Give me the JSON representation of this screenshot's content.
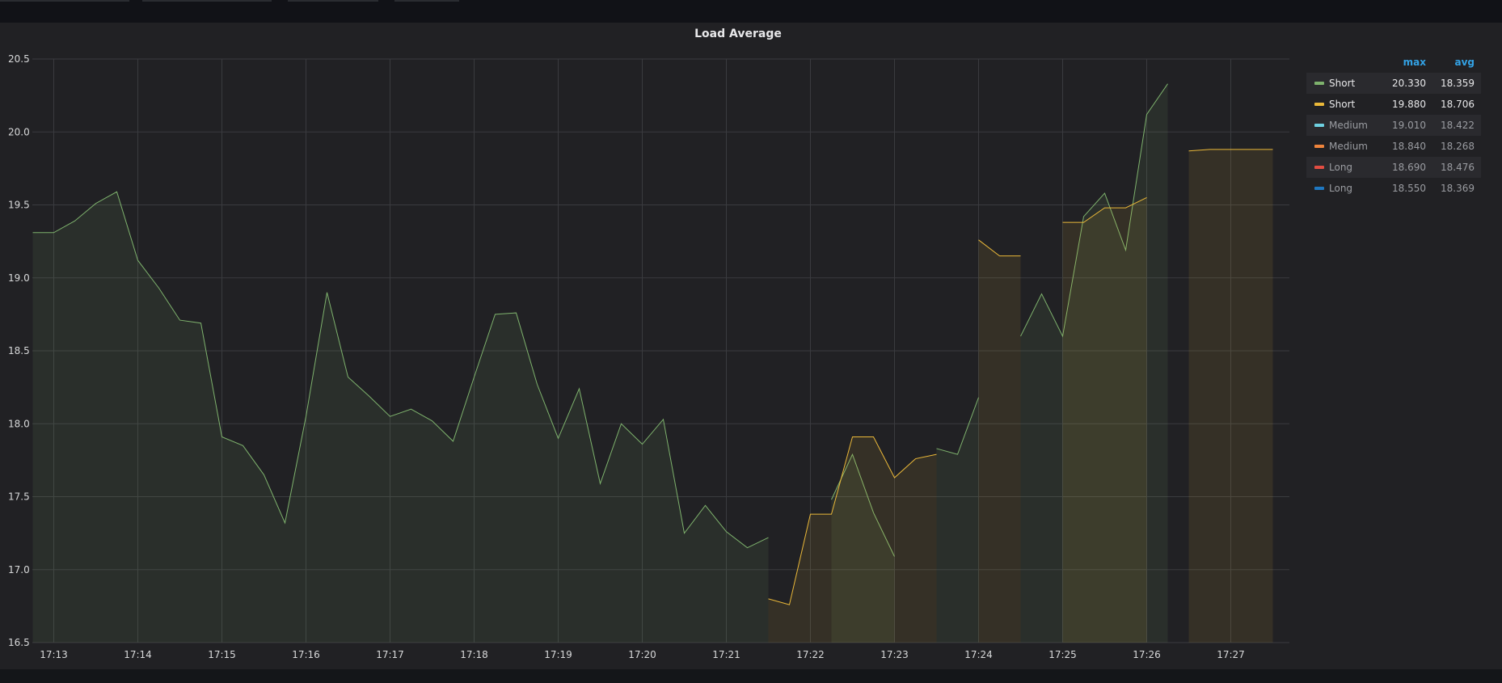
{
  "panel": {
    "title": "Load Average"
  },
  "colors": {
    "background": "#212124",
    "grid": "#3a3b3f",
    "series_short_green": "#7eb26d",
    "series_short_yellow": "#eab839",
    "series_medium_cyan": "#6ed0e0",
    "series_medium_orange": "#ef843c",
    "series_long_red": "#e24d42",
    "series_long_blue": "#1f78c1",
    "legend_header": "#33a2e5"
  },
  "legend": {
    "header_max": "max",
    "header_avg": "avg",
    "items": [
      {
        "name": "Short",
        "max": "20.330",
        "avg": "18.359",
        "color": "#7eb26d"
      },
      {
        "name": "Short",
        "max": "19.880",
        "avg": "18.706",
        "color": "#eab839"
      },
      {
        "name": "Medium",
        "max": "19.010",
        "avg": "18.422",
        "color": "#6ed0e0"
      },
      {
        "name": "Medium",
        "max": "18.840",
        "avg": "18.268",
        "color": "#ef843c"
      },
      {
        "name": "Long",
        "max": "18.690",
        "avg": "18.476",
        "color": "#e24d42"
      },
      {
        "name": "Long",
        "max": "18.550",
        "avg": "18.369",
        "color": "#1f78c1"
      }
    ]
  },
  "chart_data": {
    "type": "area",
    "title": "Load Average",
    "xlabel": "",
    "ylabel": "",
    "ylim": [
      16.5,
      20.5
    ],
    "xlim": [
      "17:12:45",
      "17:27:45"
    ],
    "grid": true,
    "legend_position": "right",
    "y_ticks": [
      "16.5",
      "17.0",
      "17.5",
      "18.0",
      "18.5",
      "19.0",
      "19.5",
      "20.0",
      "20.5"
    ],
    "x_ticks": [
      "17:13",
      "17:14",
      "17:15",
      "17:16",
      "17:17",
      "17:18",
      "17:19",
      "17:20",
      "17:21",
      "17:22",
      "17:23",
      "17:24",
      "17:25",
      "17:26",
      "17:27"
    ],
    "series": [
      {
        "name": "Short",
        "color": "#7eb26d",
        "segments": [
          [
            [
              "17:12:45",
              19.31
            ],
            [
              "17:13:00",
              19.31
            ],
            [
              "17:13:15",
              19.39
            ],
            [
              "17:13:30",
              19.51
            ],
            [
              "17:13:45",
              19.59
            ],
            [
              "17:14:00",
              19.12
            ],
            [
              "17:14:15",
              18.93
            ],
            [
              "17:14:30",
              18.71
            ],
            [
              "17:14:45",
              18.69
            ],
            [
              "17:15:00",
              17.91
            ],
            [
              "17:15:15",
              17.85
            ],
            [
              "17:15:30",
              17.65
            ],
            [
              "17:15:45",
              17.32
            ],
            [
              "17:16:00",
              18.05
            ],
            [
              "17:16:15",
              18.9
            ],
            [
              "17:16:30",
              18.32
            ],
            [
              "17:16:45",
              18.19
            ],
            [
              "17:17:00",
              18.05
            ],
            [
              "17:17:15",
              18.1
            ],
            [
              "17:17:30",
              18.02
            ],
            [
              "17:17:45",
              17.88
            ],
            [
              "17:18:00",
              18.32
            ],
            [
              "17:18:15",
              18.75
            ],
            [
              "17:18:30",
              18.76
            ],
            [
              "17:18:45",
              18.27
            ],
            [
              "17:19:00",
              17.9
            ],
            [
              "17:19:15",
              18.24
            ],
            [
              "17:19:30",
              17.59
            ],
            [
              "17:19:45",
              18.0
            ],
            [
              "17:20:00",
              17.86
            ],
            [
              "17:20:15",
              18.03
            ],
            [
              "17:20:30",
              17.25
            ],
            [
              "17:20:45",
              17.44
            ],
            [
              "17:21:00",
              17.26
            ],
            [
              "17:21:15",
              17.15
            ],
            [
              "17:21:30",
              17.22
            ]
          ],
          [
            [
              "17:22:15",
              17.48
            ],
            [
              "17:22:30",
              17.79
            ],
            [
              "17:22:45",
              17.39
            ],
            [
              "17:23:00",
              17.09
            ]
          ],
          [
            [
              "17:23:30",
              17.83
            ],
            [
              "17:23:45",
              17.79
            ],
            [
              "17:24:00",
              18.18
            ]
          ],
          [
            [
              "17:24:30",
              18.6
            ],
            [
              "17:24:45",
              18.89
            ],
            [
              "17:25:00",
              18.6
            ],
            [
              "17:25:15",
              19.42
            ],
            [
              "17:25:30",
              19.58
            ],
            [
              "17:25:45",
              19.19
            ],
            [
              "17:26:00",
              20.12
            ],
            [
              "17:26:15",
              20.33
            ]
          ]
        ]
      },
      {
        "name": "Short",
        "color": "#eab839",
        "segments": [
          [
            [
              "17:21:30",
              16.8
            ],
            [
              "17:21:45",
              16.76
            ],
            [
              "17:22:00",
              17.38
            ],
            [
              "17:22:15",
              17.38
            ],
            [
              "17:22:30",
              17.91
            ],
            [
              "17:22:45",
              17.91
            ],
            [
              "17:23:00",
              17.63
            ],
            [
              "17:23:15",
              17.76
            ],
            [
              "17:23:30",
              17.79
            ]
          ],
          [
            [
              "17:24:00",
              19.26
            ],
            [
              "17:24:15",
              19.15
            ],
            [
              "17:24:30",
              19.15
            ]
          ],
          [
            [
              "17:25:00",
              19.38
            ],
            [
              "17:25:15",
              19.38
            ],
            [
              "17:25:30",
              19.48
            ],
            [
              "17:25:45",
              19.48
            ],
            [
              "17:26:00",
              19.55
            ]
          ],
          [
            [
              "17:26:30",
              19.87
            ],
            [
              "17:26:45",
              19.88
            ],
            [
              "17:27:00",
              19.88
            ],
            [
              "17:27:15",
              19.88
            ],
            [
              "17:27:30",
              19.88
            ]
          ]
        ]
      }
    ]
  }
}
